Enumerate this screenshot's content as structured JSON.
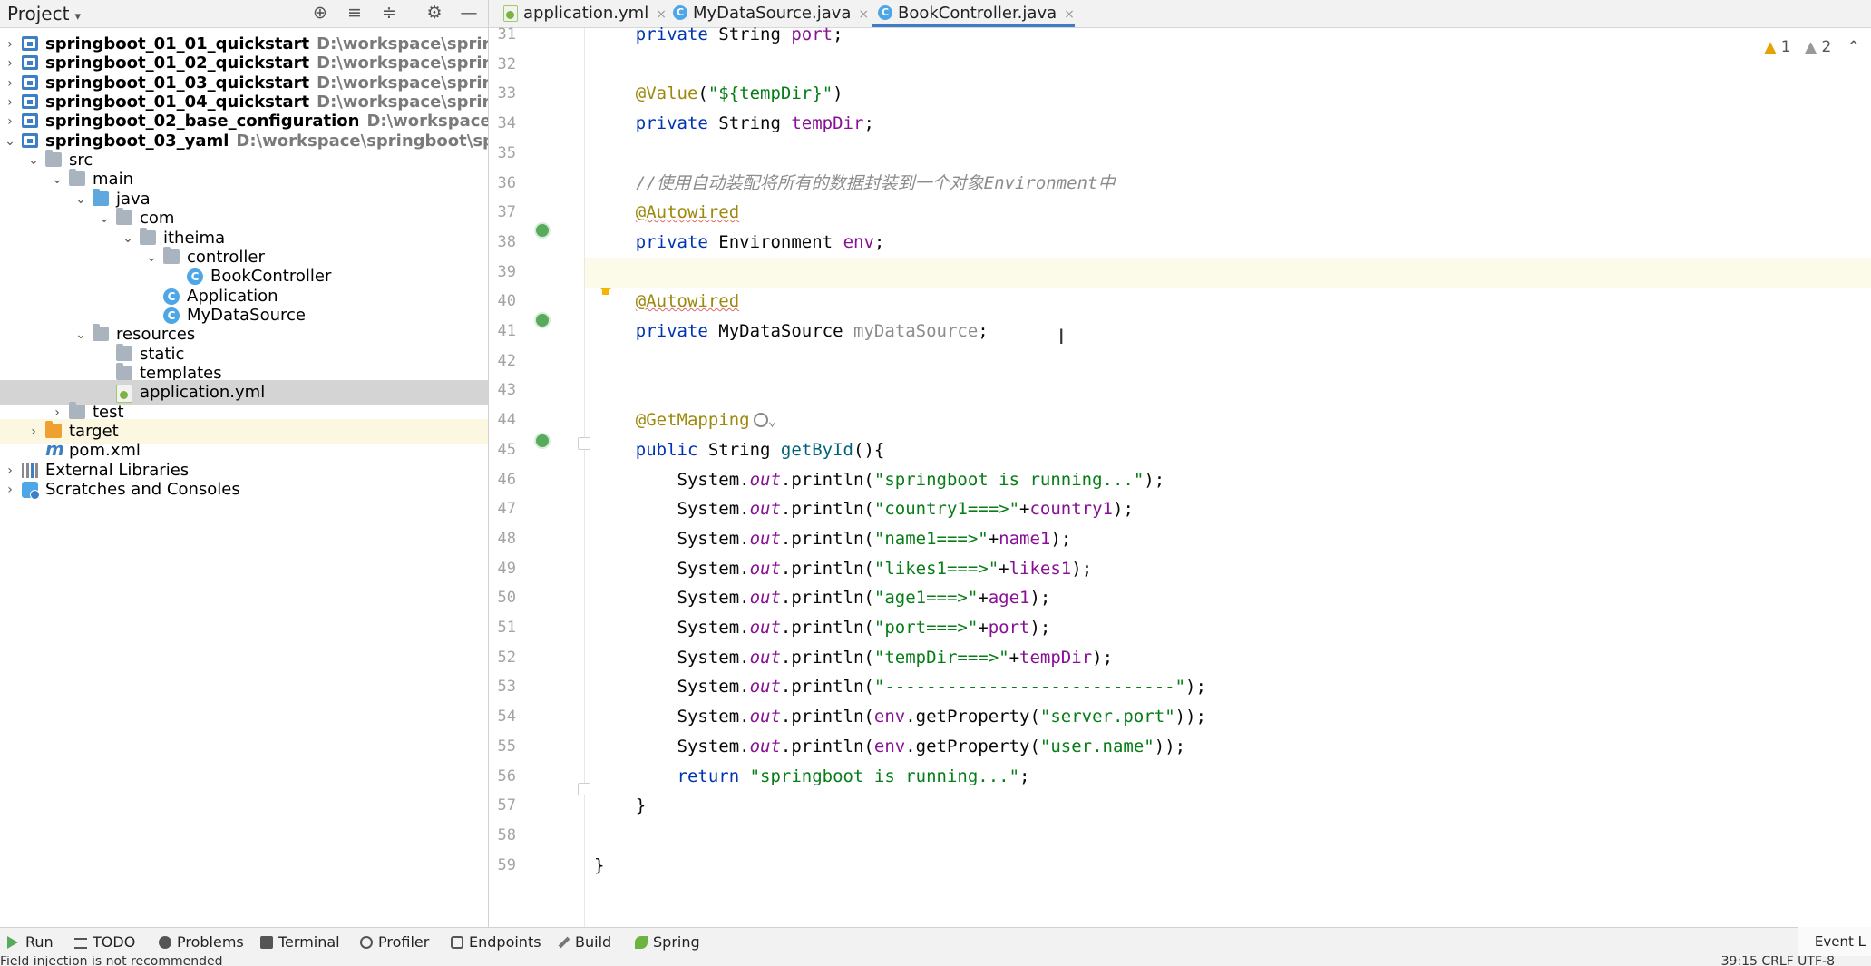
{
  "project_panel": {
    "title": "Project",
    "tree": [
      {
        "label": "springboot_01_01_quickstart",
        "path": "D:\\workspace\\springboo",
        "bold": true,
        "icon": "module-icon",
        "arrow": "›"
      },
      {
        "label": "springboot_01_02_quickstart",
        "path": "D:\\workspace\\springboo",
        "bold": true,
        "icon": "module-icon",
        "arrow": "›"
      },
      {
        "label": "springboot_01_03_quickstart",
        "path": "D:\\workspace\\springboo",
        "bold": true,
        "icon": "module-icon",
        "arrow": "›"
      },
      {
        "label": "springboot_01_04_quickstart",
        "path": "D:\\workspace\\springboo",
        "bold": true,
        "icon": "module-icon",
        "arrow": "›"
      },
      {
        "label": "springboot_02_base_configuration",
        "path": "D:\\workspace\\sprir",
        "bold": true,
        "icon": "module-icon",
        "arrow": "›"
      },
      {
        "label": "springboot_03_yaml",
        "path": "D:\\workspace\\springboot\\springb",
        "bold": true,
        "icon": "module-icon",
        "arrow": "⌄"
      },
      {
        "label": "src",
        "path": "",
        "bold": false,
        "icon": "folder-icon",
        "arrow": "⌄"
      },
      {
        "label": "main",
        "path": "",
        "bold": false,
        "icon": "folder-icon",
        "arrow": "⌄"
      },
      {
        "label": "java",
        "path": "",
        "bold": false,
        "icon": "source-folder-icon",
        "arrow": "⌄"
      },
      {
        "label": "com",
        "path": "",
        "bold": false,
        "icon": "package-icon",
        "arrow": "⌄"
      },
      {
        "label": "itheima",
        "path": "",
        "bold": false,
        "icon": "package-icon",
        "arrow": "⌄"
      },
      {
        "label": "controller",
        "path": "",
        "bold": false,
        "icon": "package-icon",
        "arrow": "⌄"
      },
      {
        "label": "BookController",
        "path": "",
        "bold": false,
        "icon": "class-icon",
        "arrow": ""
      },
      {
        "label": "Application",
        "path": "",
        "bold": false,
        "icon": "spring-class-icon",
        "arrow": ""
      },
      {
        "label": "MyDataSource",
        "path": "",
        "bold": false,
        "icon": "class-icon",
        "arrow": ""
      },
      {
        "label": "resources",
        "path": "",
        "bold": false,
        "icon": "resources-folder-icon",
        "arrow": "⌄"
      },
      {
        "label": "static",
        "path": "",
        "bold": false,
        "icon": "folder-icon",
        "arrow": ""
      },
      {
        "label": "templates",
        "path": "",
        "bold": false,
        "icon": "folder-icon",
        "arrow": ""
      },
      {
        "label": "application.yml",
        "path": "",
        "bold": false,
        "icon": "yaml-file-icon",
        "arrow": "",
        "selected": true
      },
      {
        "label": "test",
        "path": "",
        "bold": false,
        "icon": "folder-icon",
        "arrow": "›"
      },
      {
        "label": "target",
        "path": "",
        "bold": false,
        "icon": "excluded-folder-icon",
        "arrow": "›",
        "highlight": true
      },
      {
        "label": "pom.xml",
        "path": "",
        "bold": false,
        "icon": "maven-file-icon",
        "arrow": ""
      },
      {
        "label": "External Libraries",
        "path": "",
        "bold": false,
        "icon": "libraries-icon",
        "arrow": "›"
      },
      {
        "label": "Scratches and Consoles",
        "path": "",
        "bold": false,
        "icon": "scratches-icon",
        "arrow": "›"
      }
    ]
  },
  "tabs": [
    {
      "label": "application.yml",
      "icon": "yaml-file-icon",
      "active": false
    },
    {
      "label": "MyDataSource.java",
      "icon": "class-icon",
      "active": false
    },
    {
      "label": "BookController.java",
      "icon": "class-icon",
      "active": true
    }
  ],
  "inspections": {
    "warnings": "1",
    "weak_warnings": "2"
  },
  "editor": {
    "line_numbers": [
      "31",
      "32",
      "33",
      "34",
      "35",
      "36",
      "37",
      "38",
      "39",
      "40",
      "41",
      "42",
      "43",
      "44",
      "45",
      "46",
      "47",
      "48",
      "49",
      "50",
      "51",
      "52",
      "53",
      "54",
      "55",
      "56",
      "57",
      "58",
      "59"
    ],
    "lines": [
      [
        {
          "t": "    "
        },
        {
          "t": "private",
          "c": "kw"
        },
        {
          "t": " String "
        },
        {
          "t": "port",
          "c": "field"
        },
        {
          "t": ";"
        }
      ],
      [],
      [
        {
          "t": "    "
        },
        {
          "t": "@Value",
          "c": "anno"
        },
        {
          "t": "("
        },
        {
          "t": "\"${tempDir}\"",
          "c": "str"
        },
        {
          "t": ")"
        }
      ],
      [
        {
          "t": "    "
        },
        {
          "t": "private",
          "c": "kw"
        },
        {
          "t": " String "
        },
        {
          "t": "tempDir",
          "c": "field"
        },
        {
          "t": ";"
        }
      ],
      [],
      [
        {
          "t": "    "
        },
        {
          "t": "//使用自动装配将所有的数据封装到一个对象Environment中",
          "c": "comment"
        }
      ],
      [
        {
          "t": "    "
        },
        {
          "t": "@Autowired",
          "c": "anno squiggle"
        }
      ],
      [
        {
          "t": "    "
        },
        {
          "t": "private",
          "c": "kw"
        },
        {
          "t": " Environment "
        },
        {
          "t": "env",
          "c": "field"
        },
        {
          "t": ";"
        }
      ],
      [],
      [
        {
          "t": "    "
        },
        {
          "t": "@Autowired",
          "c": "anno squiggle"
        }
      ],
      [
        {
          "t": "    "
        },
        {
          "t": "private",
          "c": "kw"
        },
        {
          "t": " MyDataSource "
        },
        {
          "t": "myDataSource",
          "c": "unused"
        },
        {
          "t": ";"
        }
      ],
      [],
      [],
      [
        {
          "t": "    "
        },
        {
          "t": "@GetMapping",
          "c": "anno"
        }
      ],
      [
        {
          "t": "    "
        },
        {
          "t": "public",
          "c": "kw"
        },
        {
          "t": " String "
        },
        {
          "t": "getById",
          "c": "method"
        },
        {
          "t": "(){"
        }
      ],
      [
        {
          "t": "        System."
        },
        {
          "t": "out",
          "c": "static"
        },
        {
          "t": ".println("
        },
        {
          "t": "\"springboot is running...\"",
          "c": "str"
        },
        {
          "t": ");"
        }
      ],
      [
        {
          "t": "        System."
        },
        {
          "t": "out",
          "c": "static"
        },
        {
          "t": ".println("
        },
        {
          "t": "\"country1===>\"",
          "c": "str"
        },
        {
          "t": "+"
        },
        {
          "t": "country1",
          "c": "field"
        },
        {
          "t": ");"
        }
      ],
      [
        {
          "t": "        System."
        },
        {
          "t": "out",
          "c": "static"
        },
        {
          "t": ".println("
        },
        {
          "t": "\"name1===>\"",
          "c": "str"
        },
        {
          "t": "+"
        },
        {
          "t": "name1",
          "c": "field"
        },
        {
          "t": ");"
        }
      ],
      [
        {
          "t": "        System."
        },
        {
          "t": "out",
          "c": "static"
        },
        {
          "t": ".println("
        },
        {
          "t": "\"likes1===>\"",
          "c": "str"
        },
        {
          "t": "+"
        },
        {
          "t": "likes1",
          "c": "field"
        },
        {
          "t": ");"
        }
      ],
      [
        {
          "t": "        System."
        },
        {
          "t": "out",
          "c": "static"
        },
        {
          "t": ".println("
        },
        {
          "t": "\"age1===>\"",
          "c": "str"
        },
        {
          "t": "+"
        },
        {
          "t": "age1",
          "c": "field"
        },
        {
          "t": ");"
        }
      ],
      [
        {
          "t": "        System."
        },
        {
          "t": "out",
          "c": "static"
        },
        {
          "t": ".println("
        },
        {
          "t": "\"port===>\"",
          "c": "str"
        },
        {
          "t": "+"
        },
        {
          "t": "port",
          "c": "field"
        },
        {
          "t": ");"
        }
      ],
      [
        {
          "t": "        System."
        },
        {
          "t": "out",
          "c": "static"
        },
        {
          "t": ".println("
        },
        {
          "t": "\"tempDir===>\"",
          "c": "str"
        },
        {
          "t": "+"
        },
        {
          "t": "tempDir",
          "c": "field"
        },
        {
          "t": ");"
        }
      ],
      [
        {
          "t": "        System."
        },
        {
          "t": "out",
          "c": "static"
        },
        {
          "t": ".println("
        },
        {
          "t": "\"----------------------------\"",
          "c": "str"
        },
        {
          "t": ");"
        }
      ],
      [
        {
          "t": "        System."
        },
        {
          "t": "out",
          "c": "static"
        },
        {
          "t": ".println("
        },
        {
          "t": "env",
          "c": "field"
        },
        {
          "t": ".getProperty("
        },
        {
          "t": "\"server.port\"",
          "c": "str"
        },
        {
          "t": "));"
        }
      ],
      [
        {
          "t": "        System."
        },
        {
          "t": "out",
          "c": "static"
        },
        {
          "t": ".println("
        },
        {
          "t": "env",
          "c": "field"
        },
        {
          "t": ".getProperty("
        },
        {
          "t": "\"user.name\"",
          "c": "str"
        },
        {
          "t": "));"
        }
      ],
      [
        {
          "t": "        "
        },
        {
          "t": "return",
          "c": "kw"
        },
        {
          "t": " "
        },
        {
          "t": "\"springboot is running...\"",
          "c": "str"
        },
        {
          "t": ";"
        }
      ],
      [
        {
          "t": "    }"
        }
      ],
      [],
      [
        {
          "t": "}"
        }
      ],
      []
    ]
  },
  "tool_windows": [
    {
      "label": "Run",
      "icon": "run-icon"
    },
    {
      "label": "TODO",
      "icon": "todo-icon"
    },
    {
      "label": "Problems",
      "icon": "problems-icon"
    },
    {
      "label": "Terminal",
      "icon": "terminal-icon"
    },
    {
      "label": "Profiler",
      "icon": "profiler-icon"
    },
    {
      "label": "Endpoints",
      "icon": "endpoints-icon"
    },
    {
      "label": "Build",
      "icon": "build-icon"
    },
    {
      "label": "Spring",
      "icon": "spring-icon"
    }
  ],
  "event_log": "Event L",
  "status": {
    "message": "Field injection is not recommended",
    "position": "39:15  CRLF  UTF-8"
  }
}
